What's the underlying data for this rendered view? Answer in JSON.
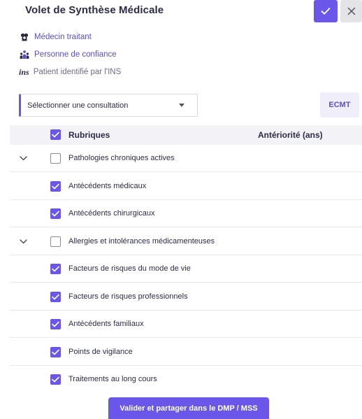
{
  "header": {
    "title": "Volet de Synthèse Médicale",
    "confirm_icon": "check-icon",
    "close_icon": "close-icon"
  },
  "info": [
    {
      "label": "Médecin traitant",
      "icon": "doctor-icon"
    },
    {
      "label": "Personne de confiance",
      "icon": "people-icon"
    },
    {
      "logo": "ins",
      "label": "Patient identifié par l'INS"
    }
  ],
  "consultation_select": {
    "value": "Sélectionner une consultation",
    "icon": "caret-down-icon"
  },
  "ecmt_button": {
    "label": "ECMT"
  },
  "table": {
    "header": {
      "rubriques_label": "Rubriques",
      "anteriorite_label": "Antériorité (ans)",
      "checked": true
    },
    "rows": [
      {
        "label": "Pathologies chroniques actives",
        "checked": false,
        "expandable": true
      },
      {
        "label": "Antécédents médicaux",
        "checked": true,
        "expandable": false
      },
      {
        "label": "Antécédents chirurgicaux",
        "checked": true,
        "expandable": false
      },
      {
        "label": "Allergies et intolérances médicamenteuses",
        "checked": false,
        "expandable": true
      },
      {
        "label": "Facteurs de risques du mode de vie",
        "checked": true,
        "expandable": false
      },
      {
        "label": "Facteurs de risques professionnels",
        "checked": true,
        "expandable": false
      },
      {
        "label": "Antécédents familiaux",
        "checked": true,
        "expandable": false
      },
      {
        "label": "Points de vigilance",
        "checked": true,
        "expandable": false
      },
      {
        "label": "Traitements au long cours",
        "checked": true,
        "expandable": false
      }
    ]
  },
  "submit_button": {
    "label": "Valider et partager dans le DMP / MSS"
  },
  "colors": {
    "accent": "#6a56e8",
    "text": "#2b2b45",
    "link": "#5a4fc9",
    "header_bg": "#f2f2f7"
  }
}
